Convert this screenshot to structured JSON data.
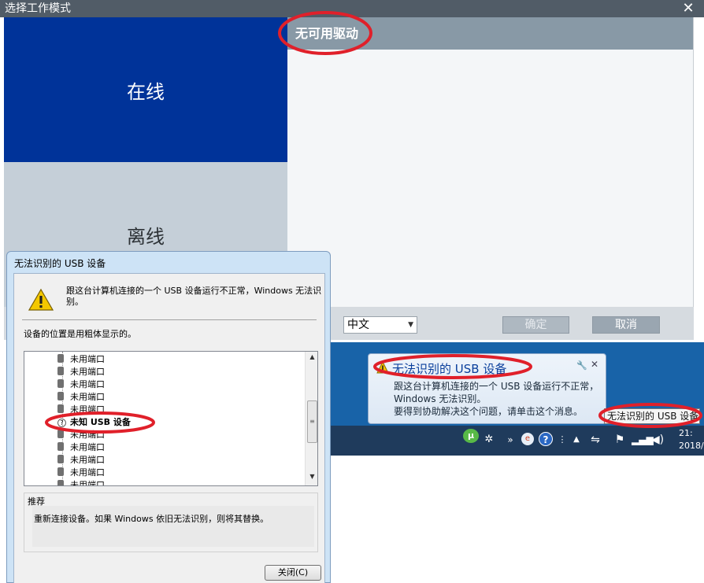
{
  "app": {
    "title": "选择工作模式",
    "close_glyph": "✕",
    "modes": [
      {
        "label": "在线"
      },
      {
        "label": "离线"
      }
    ],
    "driver_panel": {
      "header": "无可用驱动"
    },
    "language": {
      "selected": "中文"
    },
    "ok_label": "确定",
    "cancel_label": "取消",
    "colors": {
      "online": "#003399",
      "offline": "#c5cfd8",
      "panel_header": "#8899a6"
    }
  },
  "taskbar": {
    "clock_time": "21:",
    "clock_date": "2018/",
    "tray_icons": [
      "utorrent-icon",
      "bluetooth-icon",
      "browser-icon",
      "help-icon",
      "usb-icon",
      "flag-icon",
      "network-icon",
      "volume-icon"
    ]
  },
  "balloon": {
    "title": "无法识别的 USB 设备",
    "line1": "跟这台计算机连接的一个 USB 设备运行不正常，",
    "line2": "Windows 无法识别。",
    "line3": "要得到协助解决这个问题，请单击这个消息。"
  },
  "tooltip": {
    "text": "无法识别的 USB 设备"
  },
  "dialog": {
    "title": "无法识别的 USB 设备",
    "message": "跟这台计算机连接的一个 USB 设备运行不正常，Windows 无法识别。",
    "hint": "设备的位置是用粗体显示的。",
    "tree_rows": [
      {
        "label": "未用端口",
        "kind": "port"
      },
      {
        "label": "未用端口",
        "kind": "port"
      },
      {
        "label": "未用端口",
        "kind": "port"
      },
      {
        "label": "未用端口",
        "kind": "port"
      },
      {
        "label": "未用端口",
        "kind": "port"
      },
      {
        "label": "未知 USB 设备",
        "kind": "unknown"
      },
      {
        "label": "未用端口",
        "kind": "port"
      },
      {
        "label": "未用端口",
        "kind": "port"
      },
      {
        "label": "未用端口",
        "kind": "port"
      },
      {
        "label": "未用端口",
        "kind": "port"
      },
      {
        "label": "未用端口",
        "kind": "port"
      }
    ],
    "recommendation_title": "推荐",
    "recommendation_text": "重新连接设备。如果 Windows 依旧无法识别，则将其替换。",
    "close_label": "关闭(C)"
  },
  "annotation_color": "#e0202a"
}
